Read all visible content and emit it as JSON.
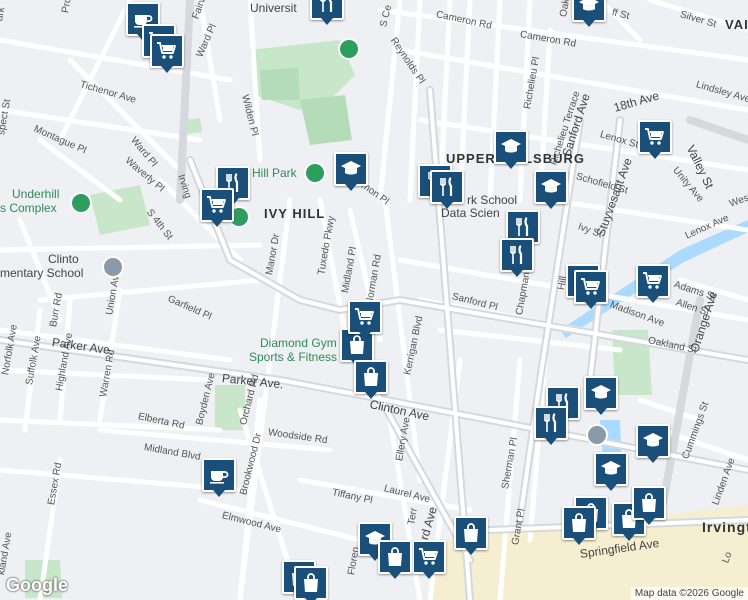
{
  "map": {
    "attribution": "Map data ©2026 Google",
    "logo": "Google",
    "colors": {
      "background": "#eef0f3",
      "park": "#c8e6c9",
      "water": "#aadaff",
      "road": "#ffffff",
      "major_road": "#d5d8dc",
      "downtown": "#f6eed1",
      "pin": "#1a4f7a",
      "park_poi": "#2e9e5f"
    }
  },
  "areas": {
    "ivy_hill": "IVY HILL",
    "upper_vailsburg": "UPPER VAILSBURG",
    "irvington": "Irvingt",
    "vail": "VAIL"
  },
  "places": {
    "university": "Universit",
    "hill_park": "Hill Park",
    "underhill_line1": "Underhill",
    "underhill_line2": "s Complex",
    "clinton_line1": "Clinto",
    "clinton_line2": "mentary School",
    "diamond_line1": "Diamond Gym",
    "diamond_line2": "Sports & Fitness",
    "newark_line1": "rk School",
    "newark_line2": "Data Scien"
  },
  "streets": {
    "tichenor": "Tichenor Ave",
    "montague": "Montague Pl",
    "ward": "Ward Pl",
    "ward_pl2": "Ward Pl",
    "waverly": "Waverly Pl",
    "s4th": "S 4th St",
    "irving": "Irving",
    "wilden": "Wilden Pl",
    "fairview": "Fairvie",
    "manor": "Manor Dr",
    "tuxedo": "Tuxedo Pkwy",
    "midland_pl": "Midland Pl",
    "norman": "Norman Rd",
    "reynolds": "Reynolds Pl",
    "cameron1": "Cameron Rd",
    "cameron2": "Cameron Rd",
    "richelieu_pl": "Richelieu Pl",
    "richelieu_terr": "Richelieu Terrace",
    "sanford": "Sanford Ave",
    "stuyvesant": "Stuyvesant Ave",
    "ave18": "18th Ave",
    "lenox": "Lenox St",
    "schofield": "Schofield St",
    "valley": "Valley St",
    "lindsley": "Lindsley Ave",
    "unity": "Unity Ave",
    "silver": "Silver St",
    "ivy_st": "Ivy St",
    "lenox_ave": "Lenox Ave",
    "adams": "Adams St",
    "allen": "Allen St",
    "madison": "Madison Ave",
    "oakland": "Oakland St",
    "orange": "Orange Ave",
    "chapman": "Chapman St",
    "hill": "Hill",
    "sanford_pl": "Sanford Pl",
    "garfield": "Garfield Pl",
    "union": "Union Ave",
    "burr": "Burr Rd",
    "norfolk": "Norfolk Ave",
    "suffolk": "Suffolk Ave",
    "highland": "Highland Ave",
    "warren": "Warren Rd",
    "parker1": "Parker Ave.",
    "parker2": "Parker Ave.",
    "boyden": "Boyden Ave",
    "orchard": "Orchard Rd",
    "elberta": "Elberta Rd",
    "midland_blvd": "Midland Blvd",
    "woodside": "Woodside Rd",
    "brookwood": "Brookwood Dr",
    "clinton_ave": "Clinton Ave",
    "kerrigan": "Kerrigan Blvd",
    "ellery": "Ellery Ave",
    "laurel": "Laurel Ave",
    "tiffany": "Tiffany Pl",
    "elmwood": "Elmwood Ave",
    "essex": "Essex Rd",
    "sherman": "Sherman Pl",
    "grant": "Grant Pl",
    "springfield": "Springfield Ave",
    "cummings": "Cummings St",
    "linden": "Linden Ave",
    "florence": "Floren",
    "terr": "Terr",
    "ard_ave": "ard Ave",
    "oakland_ave": "kland Ave",
    "prospect": "spect St",
    "oak": "Oak",
    "s_c": "S Ce",
    "ms": "mon Pl",
    "lo": "Lo",
    "west": "Wes",
    "ff": "ff St",
    "pro": "Pro",
    "ark": "ark"
  },
  "pins": [
    {
      "name": "coffee-marker",
      "icon": "coffee"
    },
    {
      "name": "grocery-marker",
      "icon": "cart"
    },
    {
      "name": "grocery-marker",
      "icon": "cart"
    },
    {
      "name": "restaurant-marker",
      "icon": "utensils"
    },
    {
      "name": "school-marker",
      "icon": "school"
    },
    {
      "name": "restaurant-marker",
      "icon": "utensils"
    },
    {
      "name": "grocery-marker",
      "icon": "cart"
    },
    {
      "name": "school-marker",
      "icon": "school"
    },
    {
      "name": "restaurant-marker",
      "icon": "utensils"
    },
    {
      "name": "restaurant-marker",
      "icon": "utensils"
    },
    {
      "name": "school-marker",
      "icon": "school"
    },
    {
      "name": "school-marker",
      "icon": "school"
    },
    {
      "name": "restaurant-marker",
      "icon": "utensils"
    },
    {
      "name": "restaurant-marker",
      "icon": "utensils"
    },
    {
      "name": "grocery-marker",
      "icon": "cart"
    },
    {
      "name": "restaurant-marker",
      "icon": "utensils"
    },
    {
      "name": "grocery-marker",
      "icon": "cart"
    },
    {
      "name": "grocery-marker",
      "icon": "cart"
    },
    {
      "name": "shopping-marker",
      "icon": "bag"
    },
    {
      "name": "shopping-marker",
      "icon": "bag"
    },
    {
      "name": "restaurant-marker",
      "icon": "utensils"
    },
    {
      "name": "school-marker",
      "icon": "school"
    },
    {
      "name": "restaurant-marker",
      "icon": "utensils"
    },
    {
      "name": "school-marker",
      "icon": "school"
    },
    {
      "name": "school-marker",
      "icon": "school"
    },
    {
      "name": "coffee-marker",
      "icon": "coffee"
    },
    {
      "name": "shopping-marker",
      "icon": "bag"
    },
    {
      "name": "shopping-marker",
      "icon": "bag"
    },
    {
      "name": "shopping-marker",
      "icon": "bag"
    },
    {
      "name": "school-marker",
      "icon": "school"
    },
    {
      "name": "shopping-marker",
      "icon": "bag"
    },
    {
      "name": "grocery-marker",
      "icon": "cart"
    },
    {
      "name": "shopping-marker",
      "icon": "bag"
    },
    {
      "name": "shopping-marker",
      "icon": "bag"
    },
    {
      "name": "shopping-marker",
      "icon": "bag"
    },
    {
      "name": "shopping-marker",
      "icon": "bag"
    },
    {
      "name": "grocery-marker",
      "icon": "cart"
    }
  ]
}
